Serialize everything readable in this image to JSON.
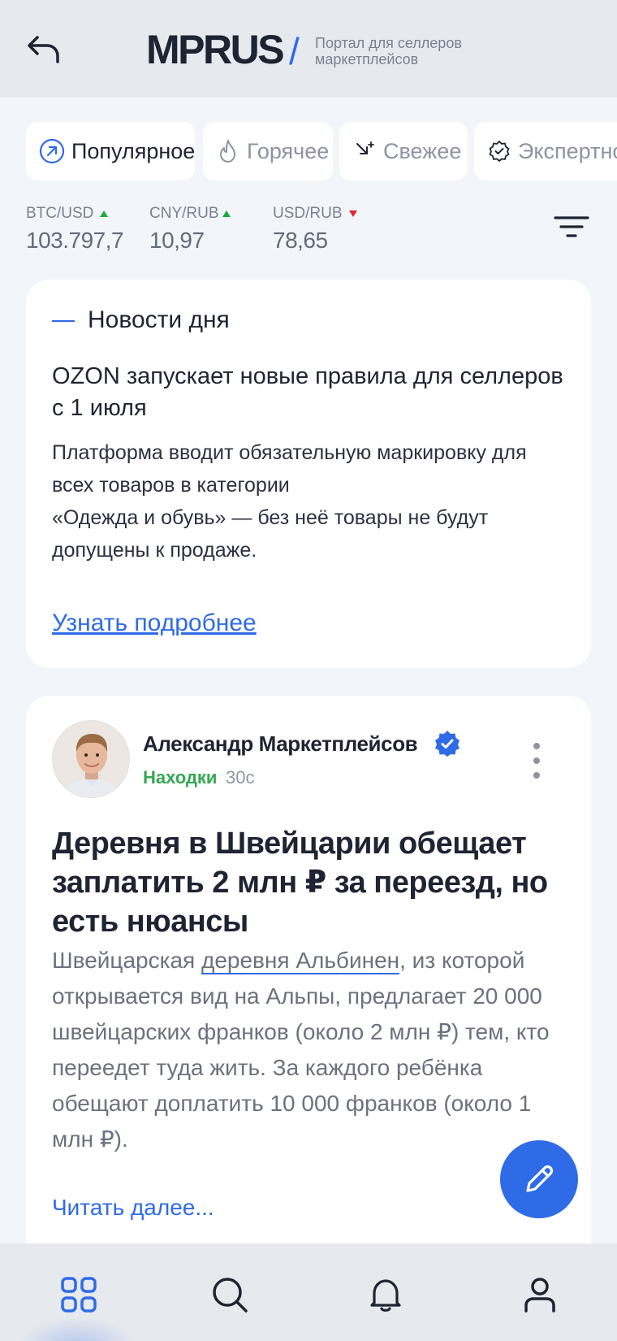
{
  "header": {
    "logo": "MPRUS",
    "slash": "/",
    "tagline": "Портал для селлеров маркетплейсов"
  },
  "tabs": [
    {
      "label": "Популярное",
      "icon": "trending-circle-icon",
      "active": true
    },
    {
      "label": "Горячее",
      "icon": "flame-icon",
      "active": false
    },
    {
      "label": "Свежее",
      "icon": "sparkle-arrow-icon",
      "active": false
    },
    {
      "label": "Экспертное",
      "icon": "badge-check-icon",
      "active": false
    }
  ],
  "rates": [
    {
      "pair": "BTC/USD",
      "value": "103.797,7",
      "trend": "up"
    },
    {
      "pair": "CNY/RUB",
      "value": "10,97",
      "trend": "up"
    },
    {
      "pair": "USD/RUB",
      "value": "78,65",
      "trend": "down"
    }
  ],
  "news": {
    "section": "Новости дня",
    "title": "OZON запускает новые правила для селлеров с 1 июля",
    "body_line1": "Платформа вводит обязательную маркировку для всех товаров в категории",
    "body_line2": "«Одежда и обувь» — без неё товары не будут допущены к продаже.",
    "link": "Узнать подробнее"
  },
  "post": {
    "author": "Александр Маркетплейсов",
    "category": "Находки",
    "time": "30с",
    "title": "Деревня в Швейцарии обещает заплатить 2 млн ₽ за переезд, но есть нюансы",
    "body_before": "Швейцарская ",
    "body_link": "деревня Альбинен",
    "body_after": ", из которой открывается вид на Альпы, предлагает 20 000 швейцарских франков (около 2 млн ₽) тем, кто переедет туда жить. За каждого ребёнка обещают доплатить 10 000 франков (около 1 млн ₽).",
    "read_more": "Читать далее..."
  },
  "bottom_nav": [
    {
      "icon": "grid-icon",
      "active": true
    },
    {
      "icon": "search-icon",
      "active": false
    },
    {
      "icon": "bell-icon",
      "active": false
    },
    {
      "icon": "profile-icon",
      "active": false
    }
  ],
  "colors": {
    "accent": "#2F6BE7",
    "up": "#1EAA3C",
    "down": "#E5232B",
    "category": "#34A853",
    "background": "#F2F5F9",
    "bar": "#E6E9EE"
  }
}
